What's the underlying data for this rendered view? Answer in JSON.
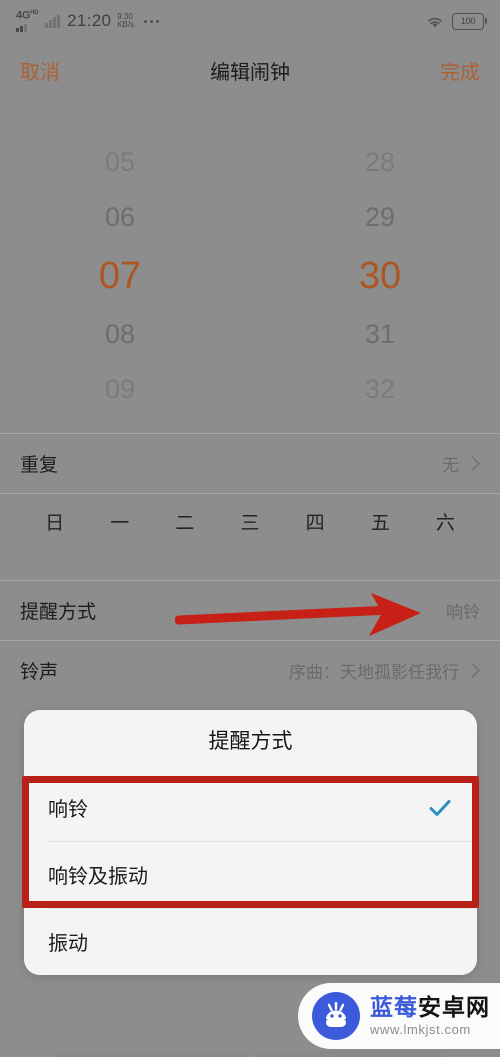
{
  "status_bar": {
    "network_type": "4G",
    "network_type_sup": "HD",
    "time": "21:20",
    "net_speed_value": "9.30",
    "net_speed_unit": "KB/s",
    "overflow_icon": "more-dots-icon",
    "wifi_icon": "wifi-icon",
    "battery_level": "100"
  },
  "header": {
    "cancel_label": "取消",
    "title": "编辑闹钟",
    "done_label": "完成",
    "accent_color": "#b3663a"
  },
  "time_picker": {
    "hours": [
      "05",
      "06",
      "07",
      "08",
      "09"
    ],
    "minutes": [
      "28",
      "29",
      "30",
      "31",
      "32"
    ],
    "selected_hour": "07",
    "selected_minute": "30",
    "selected_color": "#b35a23"
  },
  "settings": {
    "repeat": {
      "label": "重复",
      "value": "无",
      "chevron_icon": "chevron-right-icon"
    },
    "weekdays": [
      "日",
      "一",
      "二",
      "三",
      "四",
      "五",
      "六"
    ],
    "reminder_method": {
      "label": "提醒方式",
      "value": "响铃"
    },
    "ringtone": {
      "label": "铃声",
      "value": "序曲：天地孤影任我行",
      "chevron_icon": "chevron-right-icon"
    }
  },
  "dialog": {
    "title": "提醒方式",
    "options": [
      {
        "label": "响铃",
        "selected": true
      },
      {
        "label": "响铃及振动",
        "selected": false
      },
      {
        "label": "振动",
        "selected": false
      }
    ],
    "check_icon": "checkmark-icon",
    "check_color": "#2c8fc0"
  },
  "annotations": {
    "arrow_color": "#cf2218",
    "box_color": "#b92118",
    "arrow_name": "red-pointer-arrow",
    "box_name": "red-highlight-box"
  },
  "watermark": {
    "site_name_blue": "蓝莓",
    "site_name_black": "安卓网",
    "url": "www.lmkjst.com",
    "logo_icon": "android-robot-icon",
    "brand_color": "#3b5bdb"
  }
}
